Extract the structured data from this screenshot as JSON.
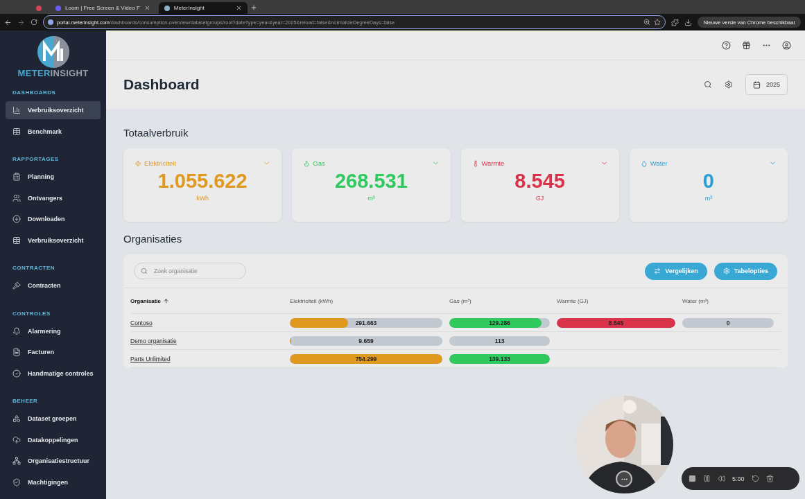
{
  "browser": {
    "tabs": [
      {
        "selected": false
      },
      {
        "title": "Loom | Free Screen & Video F",
        "selected": false
      },
      {
        "title": "MeterInsight",
        "selected": true
      }
    ],
    "url_host": "portal.meterinsight.com",
    "url_path": "/dashboards/consumption-overview/datasetgroups/root?dateType=year&year=2025&reload=false&normalizeDegreeDays=false",
    "update_button": "Nieuwe versie van Chrome beschikbaar"
  },
  "sidebar": {
    "brand_left": "METER",
    "brand_right": "INSIGHT",
    "sections": [
      {
        "title": "DASHBOARDS",
        "items": [
          {
            "label": "Verbruiksoverzicht",
            "selected": true
          },
          {
            "label": "Benchmark",
            "selected": false
          }
        ]
      },
      {
        "title": "RAPPORTAGES",
        "items": [
          {
            "label": "Planning",
            "selected": false
          },
          {
            "label": "Ontvangers",
            "selected": false
          },
          {
            "label": "Downloaden",
            "selected": false
          },
          {
            "label": "Verbruiksoverzicht",
            "selected": false
          }
        ]
      },
      {
        "title": "CONTRACTEN",
        "items": [
          {
            "label": "Contracten",
            "selected": false
          }
        ]
      },
      {
        "title": "CONTROLES",
        "items": [
          {
            "label": "Alarmering",
            "selected": false
          },
          {
            "label": "Facturen",
            "selected": false
          },
          {
            "label": "Handmatige controles",
            "selected": false
          }
        ]
      },
      {
        "title": "BEHEER",
        "items": [
          {
            "label": "Dataset groepen",
            "selected": false
          },
          {
            "label": "Datakoppelingen",
            "selected": false
          },
          {
            "label": "Organisatiestructuur",
            "selected": false
          },
          {
            "label": "Machtigingen",
            "selected": false
          }
        ]
      }
    ]
  },
  "page": {
    "title": "Dashboard",
    "year": "2025"
  },
  "totals": {
    "title": "Totaalverbruik",
    "cards": [
      {
        "label": "Elektriciteit",
        "value": "1.055.622",
        "unit": "kWh",
        "color": "#e0981f"
      },
      {
        "label": "Gas",
        "value": "268.531",
        "unit": "m³",
        "color": "#2fc95e"
      },
      {
        "label": "Warmte",
        "value": "8.545",
        "unit": "GJ",
        "color": "#d9334a"
      },
      {
        "label": "Water",
        "value": "0",
        "unit": "m³",
        "color": "#2a9fd6"
      }
    ]
  },
  "organisations": {
    "title": "Organisaties",
    "search_placeholder": "Zoek organisatie",
    "buttons": [
      "Vergelijken",
      "Tabelopties"
    ],
    "columns": [
      {
        "label": "Organisatie",
        "sorted": true
      },
      {
        "label": "Elektriciteit (kWh)",
        "color": "#e0981f"
      },
      {
        "label": "Gas (m³)",
        "color": "#2fc95e"
      },
      {
        "label": "Warmte (GJ)",
        "color": "#d9334a"
      },
      {
        "label": "Water (m³)"
      }
    ],
    "rows": [
      {
        "name": "Contoso",
        "cells": [
          {
            "text": "291.663",
            "level": 0.38
          },
          {
            "text": "129.286",
            "level": 0.92
          },
          {
            "text": "8.545",
            "level": 1
          },
          {
            "text": "0"
          }
        ]
      },
      {
        "name": "Demo organisatie",
        "cells": [
          {
            "text": "9.659",
            "level": 0.01
          },
          {
            "text": "113"
          }
        ]
      },
      {
        "name": "Parts Unlimited",
        "cells": [
          {
            "text": "754.299",
            "level": 1
          },
          {
            "text": "139.133",
            "level": 1
          }
        ]
      }
    ]
  },
  "recorder": {
    "time": "5:00"
  }
}
